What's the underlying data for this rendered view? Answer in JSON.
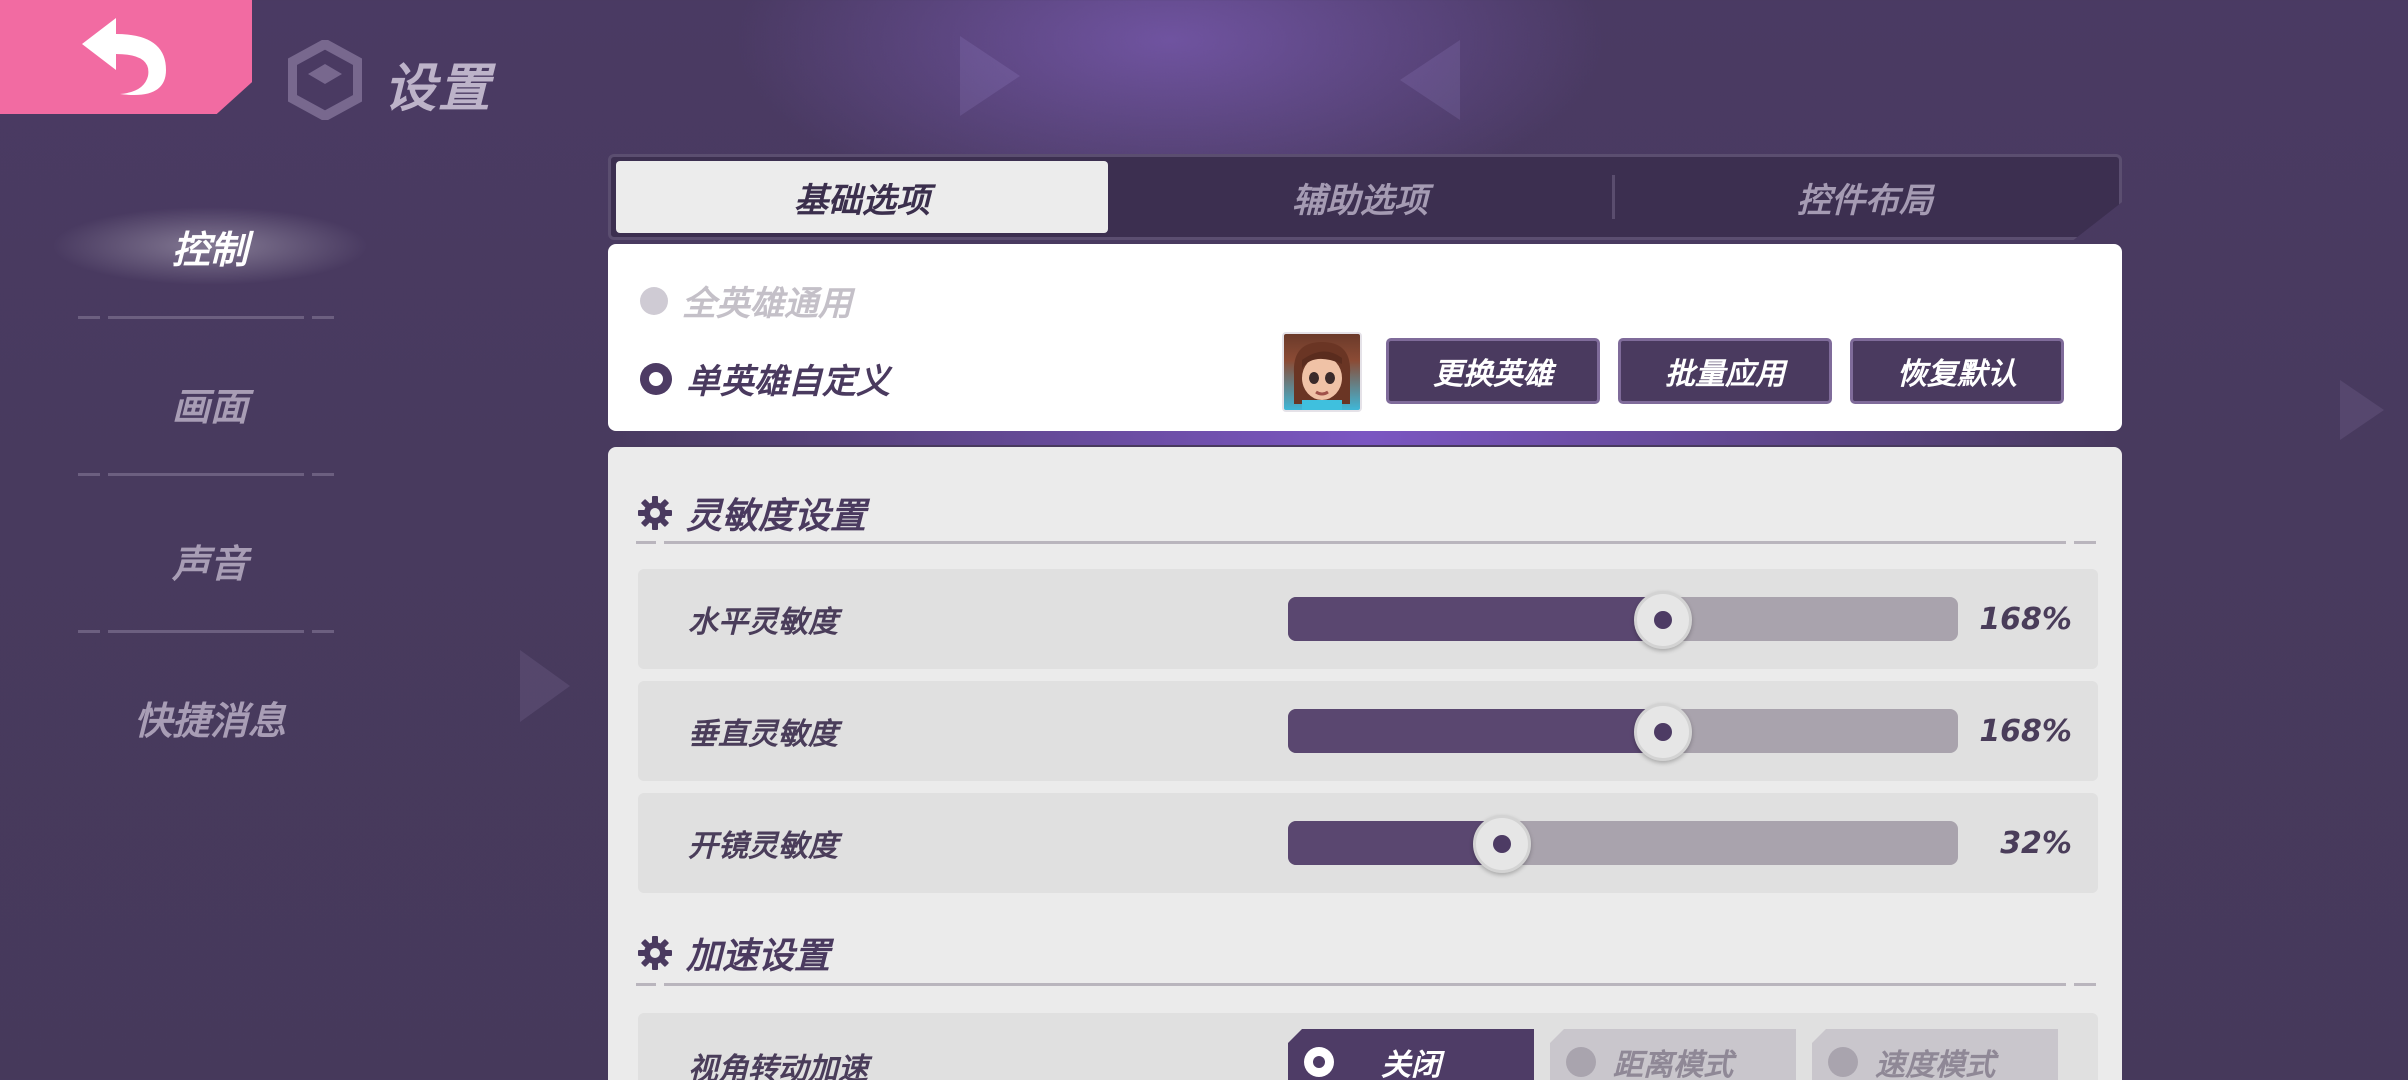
{
  "header": {
    "title": "设置"
  },
  "nav": {
    "items": [
      "控制",
      "画面",
      "声音",
      "快捷消息"
    ],
    "active": "控制"
  },
  "tabs": [
    "基础选项",
    "辅助选项",
    "控件布局"
  ],
  "hero": {
    "all_heroes_label": "全英雄通用",
    "single_hero_label": "单英雄自定义",
    "buttons": [
      "更换英雄",
      "批量应用",
      "恢复默认"
    ]
  },
  "sensitivity": {
    "title": "灵敏度设置",
    "rows": [
      {
        "label": "水平灵敏度",
        "value": "168%",
        "level": 0.56
      },
      {
        "label": "垂直灵敏度",
        "value": "168%",
        "level": 0.56
      },
      {
        "label": "开镜灵敏度",
        "value": "32%",
        "level": 0.32
      }
    ]
  },
  "acceleration": {
    "title": "加速设置",
    "row_label": "视角转动加速",
    "options": [
      "关闭",
      "距离模式",
      "速度模式"
    ],
    "selected": "关闭"
  },
  "colors": {
    "accent": "#f26ba2",
    "primary": "#4a3a5f",
    "track_fill": "#5a4770"
  }
}
